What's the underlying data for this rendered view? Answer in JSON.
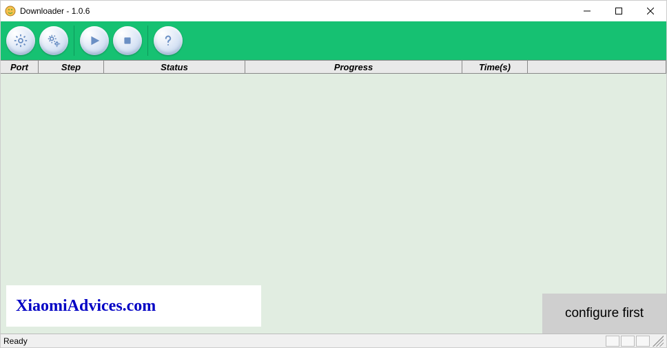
{
  "window": {
    "title": "Downloader - 1.0.6"
  },
  "toolbar": {
    "buttons": {
      "settings": "settings",
      "settings2": "settings2",
      "play": "play",
      "stop": "stop",
      "help": "help"
    }
  },
  "columns": {
    "port": "Port",
    "step": "Step",
    "status": "Status",
    "progress": "Progress",
    "time": "Time(s)"
  },
  "watermark": "XiaomiAdvices.com",
  "configure_button": "configure first",
  "statusbar": {
    "text": "Ready"
  }
}
